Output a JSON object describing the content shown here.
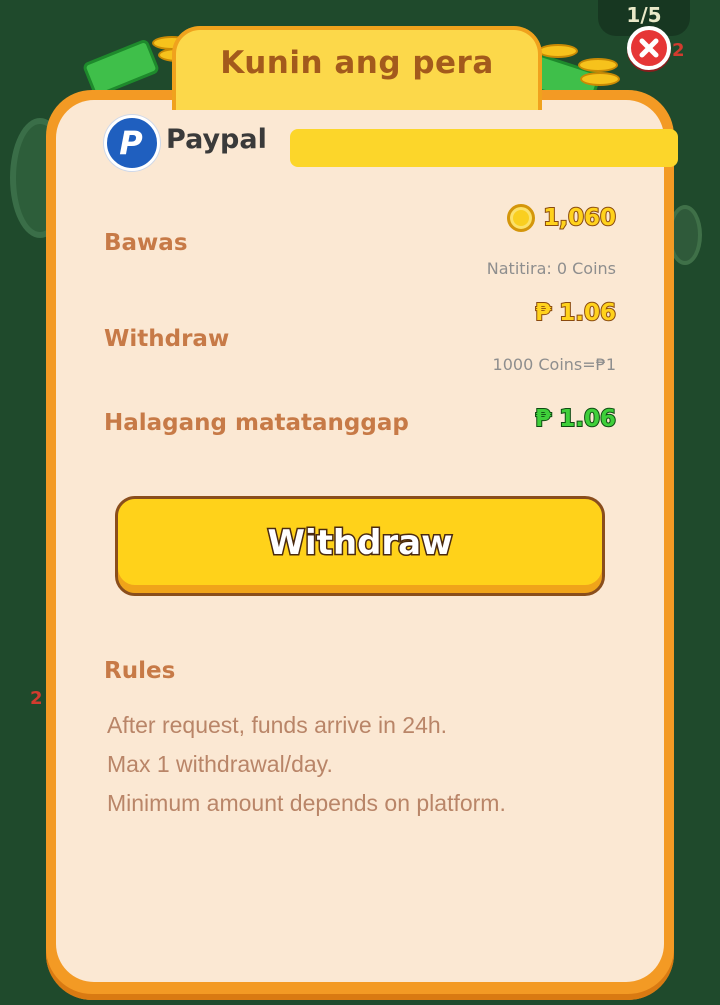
{
  "background": {
    "counter_text": "1/5",
    "side_number_left": "2",
    "side_number_right": "2"
  },
  "dialog": {
    "title": "Kunin ang pera",
    "close_icon": "close-icon",
    "payment_method": {
      "name": "Paypal",
      "logo_letter": "P",
      "account_value": ""
    },
    "rows": {
      "deduct": {
        "label": "Bawas",
        "value": "1,060",
        "note": "Natitira: 0 Coins"
      },
      "withdraw": {
        "label": "Withdraw",
        "value": "₱ 1.06",
        "note": "1000 Coins=₱1"
      },
      "receive": {
        "label": "Halagang matatanggap",
        "value": "₱ 1.06"
      }
    },
    "withdraw_button": "Withdraw",
    "rules": {
      "title": "Rules",
      "items": [
        "After request, funds arrive in 24h.",
        "Max 1 withdrawal/day.",
        "Minimum amount depends on platform."
      ]
    },
    "colors": {
      "card_border": "#f39a24",
      "card_fill": "#fbe8d3",
      "accent_yellow": "#ffd21a",
      "label_brown": "#c77a47",
      "receive_green": "#3fcf3a"
    }
  }
}
